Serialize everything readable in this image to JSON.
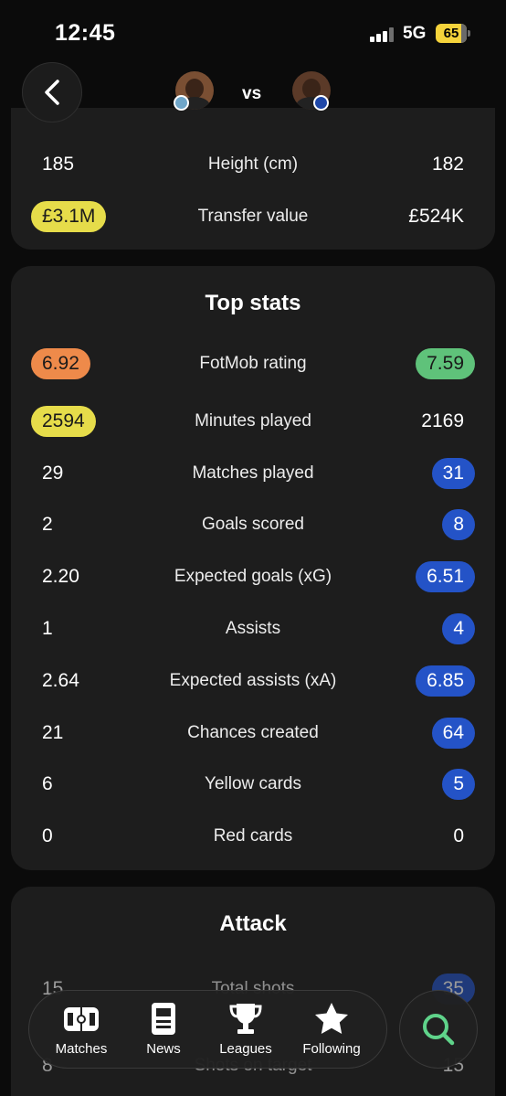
{
  "status_bar": {
    "time": "12:45",
    "network": "5G",
    "battery": "65"
  },
  "header": {
    "vs_text": "vs"
  },
  "card_1": {
    "rows": [
      {
        "left": "185",
        "label": "Height (cm)",
        "right": "182"
      },
      {
        "left": "£3.1M",
        "label": "Transfer value",
        "right": "£524K"
      }
    ]
  },
  "top_stats": {
    "title": "Top stats",
    "rows": [
      {
        "left": "6.92",
        "label": "FotMob rating",
        "right": "7.59"
      },
      {
        "left": "2594",
        "label": "Minutes played",
        "right": "2169"
      },
      {
        "left": "29",
        "label": "Matches played",
        "right": "31"
      },
      {
        "left": "2",
        "label": "Goals scored",
        "right": "8"
      },
      {
        "left": "2.20",
        "label": "Expected goals (xG)",
        "right": "6.51"
      },
      {
        "left": "1",
        "label": "Assists",
        "right": "4"
      },
      {
        "left": "2.64",
        "label": "Expected assists (xA)",
        "right": "6.85"
      },
      {
        "left": "21",
        "label": "Chances created",
        "right": "64"
      },
      {
        "left": "6",
        "label": "Yellow cards",
        "right": "5"
      },
      {
        "left": "0",
        "label": "Red cards",
        "right": "0"
      }
    ]
  },
  "attack": {
    "title": "Attack",
    "rows": [
      {
        "left": "15",
        "label": "Total shots",
        "right": "35"
      },
      {
        "left": "8",
        "label": "Shots on target",
        "right": "15"
      }
    ]
  },
  "nav": {
    "items": [
      {
        "label": "Matches",
        "icon": "pitch-icon"
      },
      {
        "label": "News",
        "icon": "news-icon"
      },
      {
        "label": "Leagues",
        "icon": "trophy-icon"
      },
      {
        "label": "Following",
        "icon": "star-icon"
      }
    ],
    "search_icon": "search-icon"
  },
  "colors": {
    "highlight_yellow": "#e6dc4a",
    "highlight_orange": "#ee8a4a",
    "highlight_green": "#5fc27a",
    "highlight_blue": "#2453c7",
    "search_accent": "#5fd38a"
  }
}
